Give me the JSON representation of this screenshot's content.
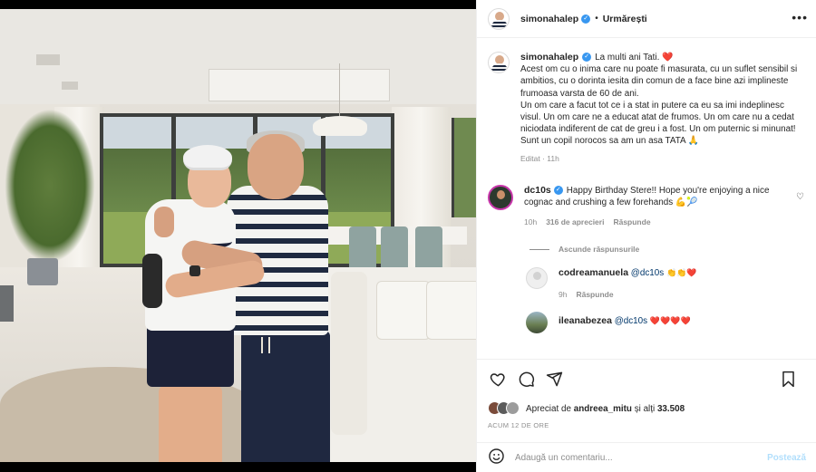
{
  "header": {
    "username": "simonahalep",
    "separator": "•",
    "follow_label": "Urmărești",
    "more_label": "•••"
  },
  "caption": {
    "username": "simonahalep",
    "lines": [
      "La multi ani Tati. ❤️",
      "Acest om cu o inima care nu poate fi masurata, cu un suflet sensibil si ambitios, cu o dorinta iesita din comun de a face bine azi implineste frumoasa varsta de 60 de ani.",
      "Un om care a facut tot ce i a stat in putere ca eu sa imi indeplinesc visul. Un om care ne a educat atat de frumos. Un om care nu a cedat niciodata indiferent de cat de greu i a fost. Un om puternic si minunat!",
      "Sunt un copil norocos sa am un asa TATA 🙏"
    ],
    "meta": "Editat · 11h"
  },
  "comment": {
    "username": "dc10s",
    "text": "Happy Birthday Stere!! Hope you're enjoying a nice cognac and crushing a few forehands 💪🎾",
    "time": "10h",
    "likes": "316 de aprecieri",
    "reply_label": "Răspunde"
  },
  "hide_replies_label": "Ascunde răspunsurile",
  "replies": [
    {
      "username": "codreamanuela",
      "mention": "@dc10s",
      "emoji": "👏👏❤️",
      "time": "9h",
      "reply_label": "Răspunde"
    },
    {
      "username": "ileanabezea",
      "mention": "@dc10s",
      "emoji": "❤️❤️❤️❤️"
    }
  ],
  "likes": {
    "prefix": "Apreciat de",
    "user": "andreea_mitu",
    "suffix": "și alți",
    "count": "33.508"
  },
  "timestamp": "ACUM 12 DE ORE",
  "composer": {
    "placeholder": "Adaugă un comentariu...",
    "post_label": "Postează"
  },
  "colors": {
    "verified": "#3897f0",
    "link": "#00376b",
    "post_disabled": "#b2dffc",
    "heart": "#ed1943"
  },
  "icons": [
    "verified-icon",
    "more-icon",
    "heart-icon",
    "comment-icon",
    "share-icon",
    "bookmark-icon",
    "emoji-icon"
  ]
}
